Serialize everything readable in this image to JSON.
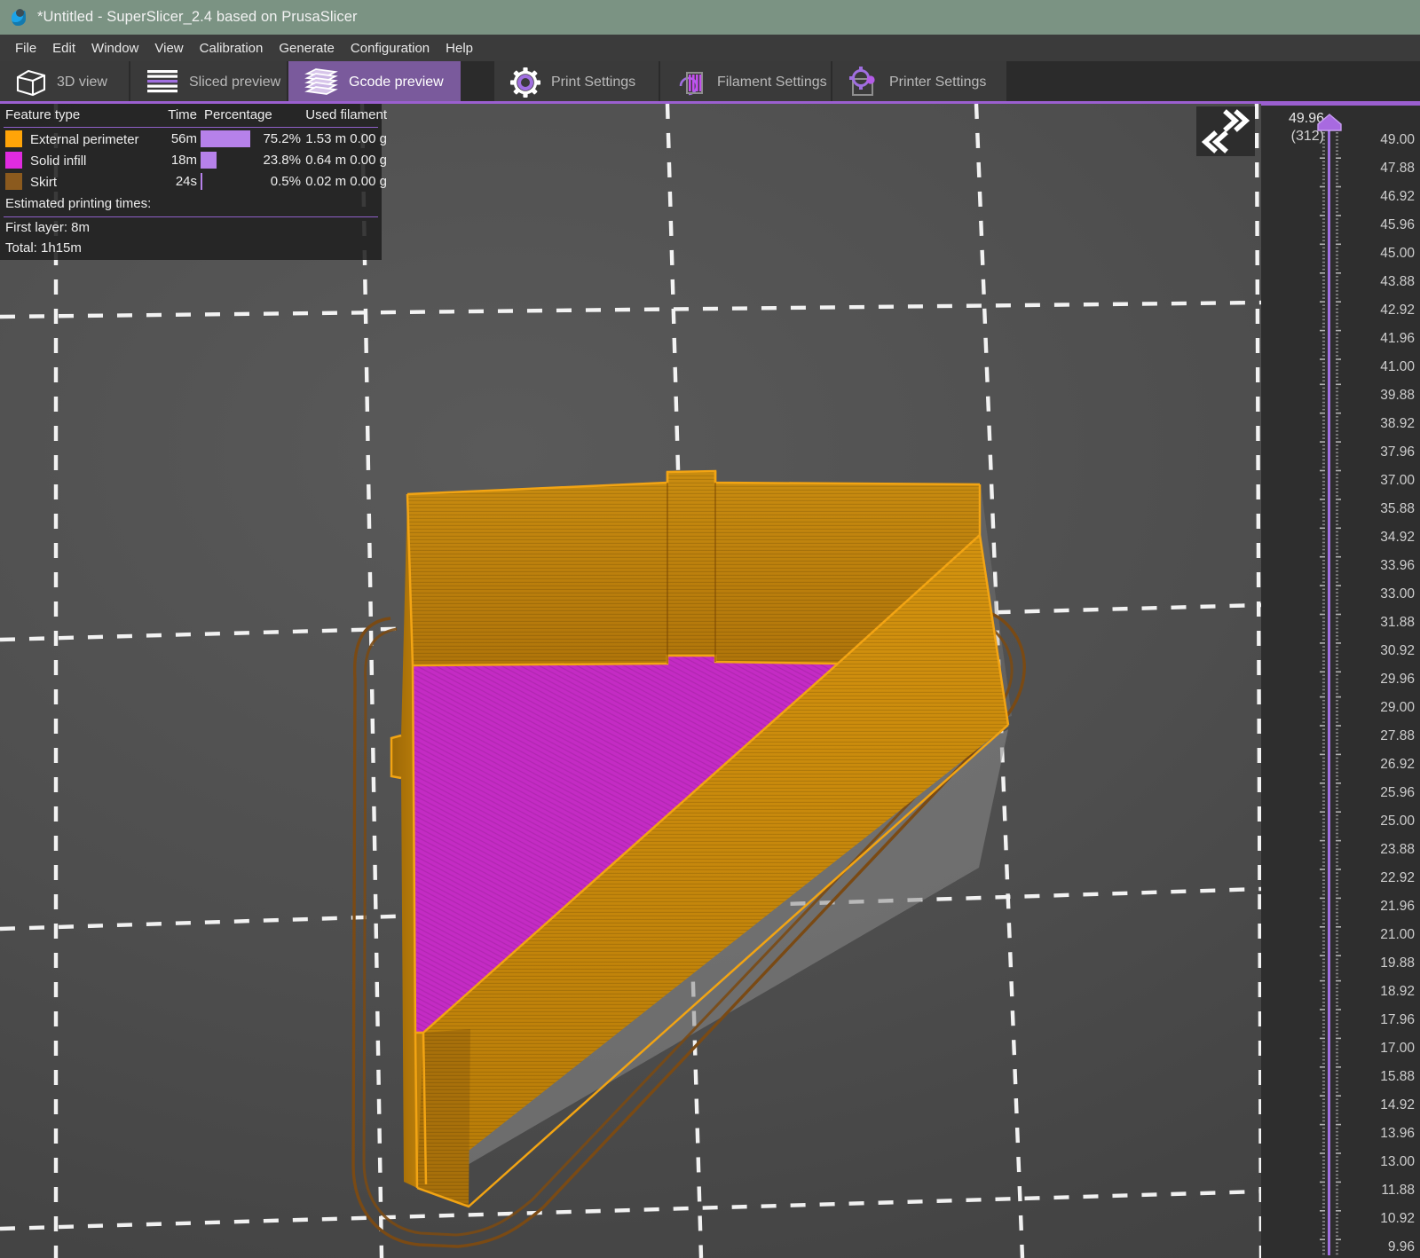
{
  "window": {
    "title": "*Untitled - SuperSlicer_2.4  based on PrusaSlicer",
    "icon": "app-icon"
  },
  "menu": {
    "items": [
      {
        "label": "File"
      },
      {
        "label": "Edit"
      },
      {
        "label": "Window"
      },
      {
        "label": "View"
      },
      {
        "label": "Calibration"
      },
      {
        "label": "Generate"
      },
      {
        "label": "Configuration"
      },
      {
        "label": "Help"
      }
    ]
  },
  "view_tabs": [
    {
      "label": "3D view",
      "icon": "cube-icon",
      "active": false
    },
    {
      "label": "Sliced preview",
      "icon": "layers-flat-icon",
      "active": false
    },
    {
      "label": "Gcode preview",
      "icon": "layers-stack-icon",
      "active": true
    }
  ],
  "settings_tabs": [
    {
      "label": "Print Settings",
      "icon": "gear-icon"
    },
    {
      "label": "Filament Settings",
      "icon": "filament-spool-icon"
    },
    {
      "label": "Printer Settings",
      "icon": "printer-gear-icon"
    }
  ],
  "legend": {
    "headers": {
      "feature_type": "Feature type",
      "time": "Time",
      "percentage": "Percentage",
      "used_filament": "Used filament"
    },
    "rows": [
      {
        "color": "#FFA408",
        "name": "External perimeter",
        "time": "56m",
        "percent": "75.2%",
        "percent_value": 75.2,
        "length": "1.53 m",
        "weight": "0.00 g"
      },
      {
        "color": "#E02BE0",
        "name": "Solid infill",
        "time": "18m",
        "percent": "23.8%",
        "percent_value": 23.8,
        "length": "0.64 m",
        "weight": "0.00 g"
      },
      {
        "color": "#8B5A1E",
        "name": "Skirt",
        "time": "24s",
        "percent": "0.5%",
        "percent_value": 0.5,
        "length": "0.02 m",
        "weight": "0.00 g"
      }
    ],
    "estimated_label": "Estimated printing times:",
    "first_layer": "First layer: 8m",
    "total": "Total:       1h15m",
    "bar_color": "#B681EA",
    "separator_color": "#8E5FC8"
  },
  "collapse_button": {
    "name": "collapse-sidebar-button",
    "glyph_top": "chevron-double-right-icon",
    "glyph_bottom": "chevron-double-left-icon"
  },
  "layer_slider": {
    "current_value": "49.96",
    "current_layer": "(312)",
    "accent_color": "#A06FE0",
    "ticks": [
      "49.00",
      "47.88",
      "46.92",
      "45.96",
      "45.00",
      "43.88",
      "42.92",
      "41.96",
      "41.00",
      "39.88",
      "38.92",
      "37.96",
      "37.00",
      "35.88",
      "34.92",
      "33.96",
      "33.00",
      "31.88",
      "30.92",
      "29.96",
      "29.00",
      "27.88",
      "26.92",
      "25.96",
      "25.00",
      "23.88",
      "22.92",
      "21.96",
      "21.00",
      "19.88",
      "18.92",
      "17.96",
      "17.00",
      "15.88",
      "14.92",
      "13.96",
      "13.00",
      "11.88",
      "10.92",
      "9.96"
    ]
  },
  "viewport": {
    "background_color": "#4E4E4E",
    "grid_color": "#FFFFFF",
    "model": {
      "perimeter_color": "#C8860D",
      "perimeter_edge_color": "#F2A413",
      "infill_color": "#C42BC4",
      "skirt_color": "#7A4A14",
      "shadow_color": "#8A8A8A"
    }
  }
}
